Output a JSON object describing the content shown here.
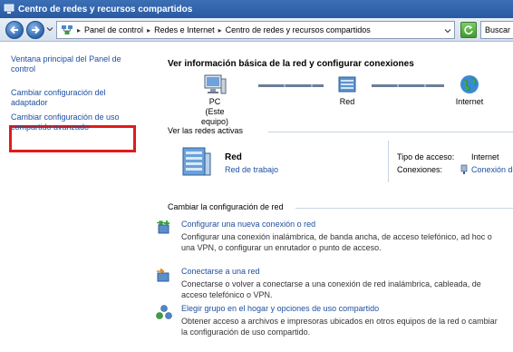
{
  "window": {
    "title": "Centro de redes y recursos compartidos"
  },
  "address": {
    "crumbs": [
      "Panel de control",
      "Redes e Internet",
      "Centro de redes y recursos compartidos"
    ],
    "search_placeholder": "Buscar"
  },
  "sidebar": {
    "items": [
      {
        "label": "Ventana principal del Panel de control"
      },
      {
        "label": "Cambiar configuración del adaptador",
        "highlighted": true
      },
      {
        "label": "Cambiar configuración de uso compartido avanzado"
      }
    ],
    "highlight_color": "#e01b1b"
  },
  "main": {
    "heading": "Ver información básica de la red y configurar conexiones",
    "map": {
      "pc_label": "PC",
      "pc_sublabel": "(Este equipo)",
      "net_label": "Red",
      "internet_label": "Internet"
    },
    "active_networks": {
      "section_title": "Ver las redes activas",
      "network_name": "Red",
      "network_type": "Red de trabajo",
      "access_type_key": "Tipo de acceso:",
      "access_type_value": "Internet",
      "connections_key": "Conexiones:",
      "connections_value": "Conexión de"
    },
    "change_settings": {
      "section_title": "Cambiar la configuración de red",
      "tasks": [
        {
          "title": "Configurar una nueva conexión o red",
          "description": "Configurar una conexión inalámbrica, de banda ancha, de acceso telefónico, ad hoc o una VPN, o configurar un enrutador o punto de acceso.",
          "icon": "new-connection-icon"
        },
        {
          "title": "Conectarse a una red",
          "description": "Conectarse o volver a conectarse a una conexión de red inalámbrica, cableada, de acceso telefónico o VPN.",
          "icon": "connect-network-icon"
        },
        {
          "title": "Elegir grupo en el hogar y opciones de uso compartido",
          "description": "Obtener acceso a archivos e impresoras ubicados en otros equipos de la red o cambiar la configuración de uso compartido.",
          "icon": "homegroup-icon"
        }
      ]
    }
  },
  "colors": {
    "link": "#1f4fa0",
    "titlebar": "#2a5aa1"
  }
}
